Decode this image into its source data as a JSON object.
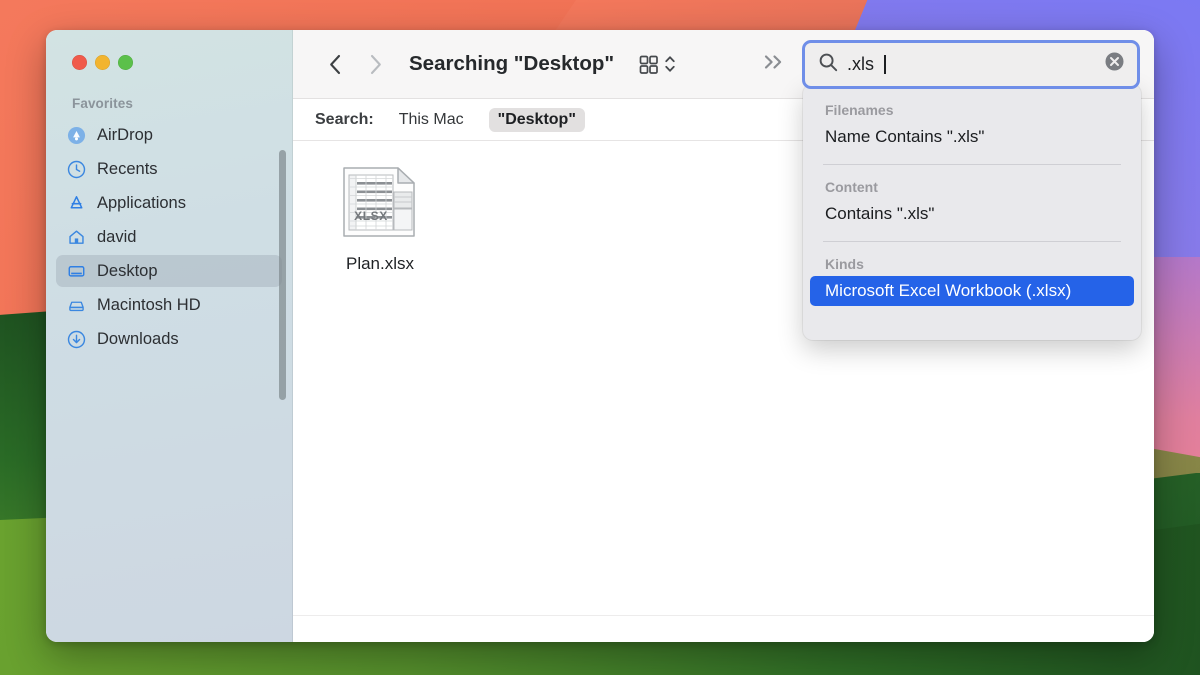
{
  "wallpaper": {
    "colors": {
      "coral": "#f4785b",
      "purple": "#7b79f3",
      "pink": "#e07f9e",
      "green_dark": "#1d4e20",
      "green_light": "#6aa22f",
      "olive": "#8d8b4c"
    }
  },
  "window": {
    "title": "Searching \"Desktop\"",
    "traffic_lights": [
      {
        "name": "close",
        "color": "#f05a4b"
      },
      {
        "name": "minimize",
        "color": "#f2b42f"
      },
      {
        "name": "maximize",
        "color": "#5bc04a"
      }
    ]
  },
  "toolbar": {
    "back_label": "Back",
    "forward_label": "Forward",
    "view_label": "Icon View",
    "arrange_label": "Group / Arrange",
    "more_label": "More toolbar items",
    "icons": {
      "back": "chevron-left-icon",
      "forward": "chevron-right-icon",
      "view": "grid-view-icon",
      "stepper": "chevron-up-down-icon",
      "more": "double-chevron-right-icon"
    }
  },
  "search": {
    "value": ".xls",
    "placeholder": "Search",
    "icon": "search-icon",
    "clear_icon": "clear-circle-icon",
    "accent": "#6f8ee8"
  },
  "suggestions": {
    "groups": [
      {
        "label": "Filenames",
        "rows": [
          {
            "text": "Name Contains \".xls\"",
            "highlighted": false
          }
        ]
      },
      {
        "label": "Content",
        "rows": [
          {
            "text": "Contains \".xls\"",
            "highlighted": false
          }
        ]
      },
      {
        "label": "Kinds",
        "rows": [
          {
            "text": "Microsoft Excel Workbook (.xlsx)",
            "highlighted": true
          }
        ]
      }
    ],
    "highlight_color": "#2563e8"
  },
  "scope": {
    "label": "Search:",
    "options": [
      {
        "label": "This Mac",
        "active": false
      },
      {
        "label": "\"Desktop\"",
        "active": true
      }
    ]
  },
  "sidebar": {
    "group_title": "Favorites",
    "items": [
      {
        "label": "AirDrop",
        "icon": "airdrop-icon",
        "selected": false
      },
      {
        "label": "Recents",
        "icon": "clock-icon",
        "selected": false
      },
      {
        "label": "Applications",
        "icon": "apps-icon",
        "selected": false
      },
      {
        "label": "david",
        "icon": "home-icon",
        "selected": false
      },
      {
        "label": "Desktop",
        "icon": "desktop-icon",
        "selected": true
      },
      {
        "label": "Macintosh HD",
        "icon": "harddisk-icon",
        "selected": false
      },
      {
        "label": "Downloads",
        "icon": "download-icon",
        "selected": false
      }
    ]
  },
  "files": [
    {
      "name": "Plan.xlsx",
      "icon": "xlsx-file-icon",
      "badge": "XLSX"
    }
  ]
}
